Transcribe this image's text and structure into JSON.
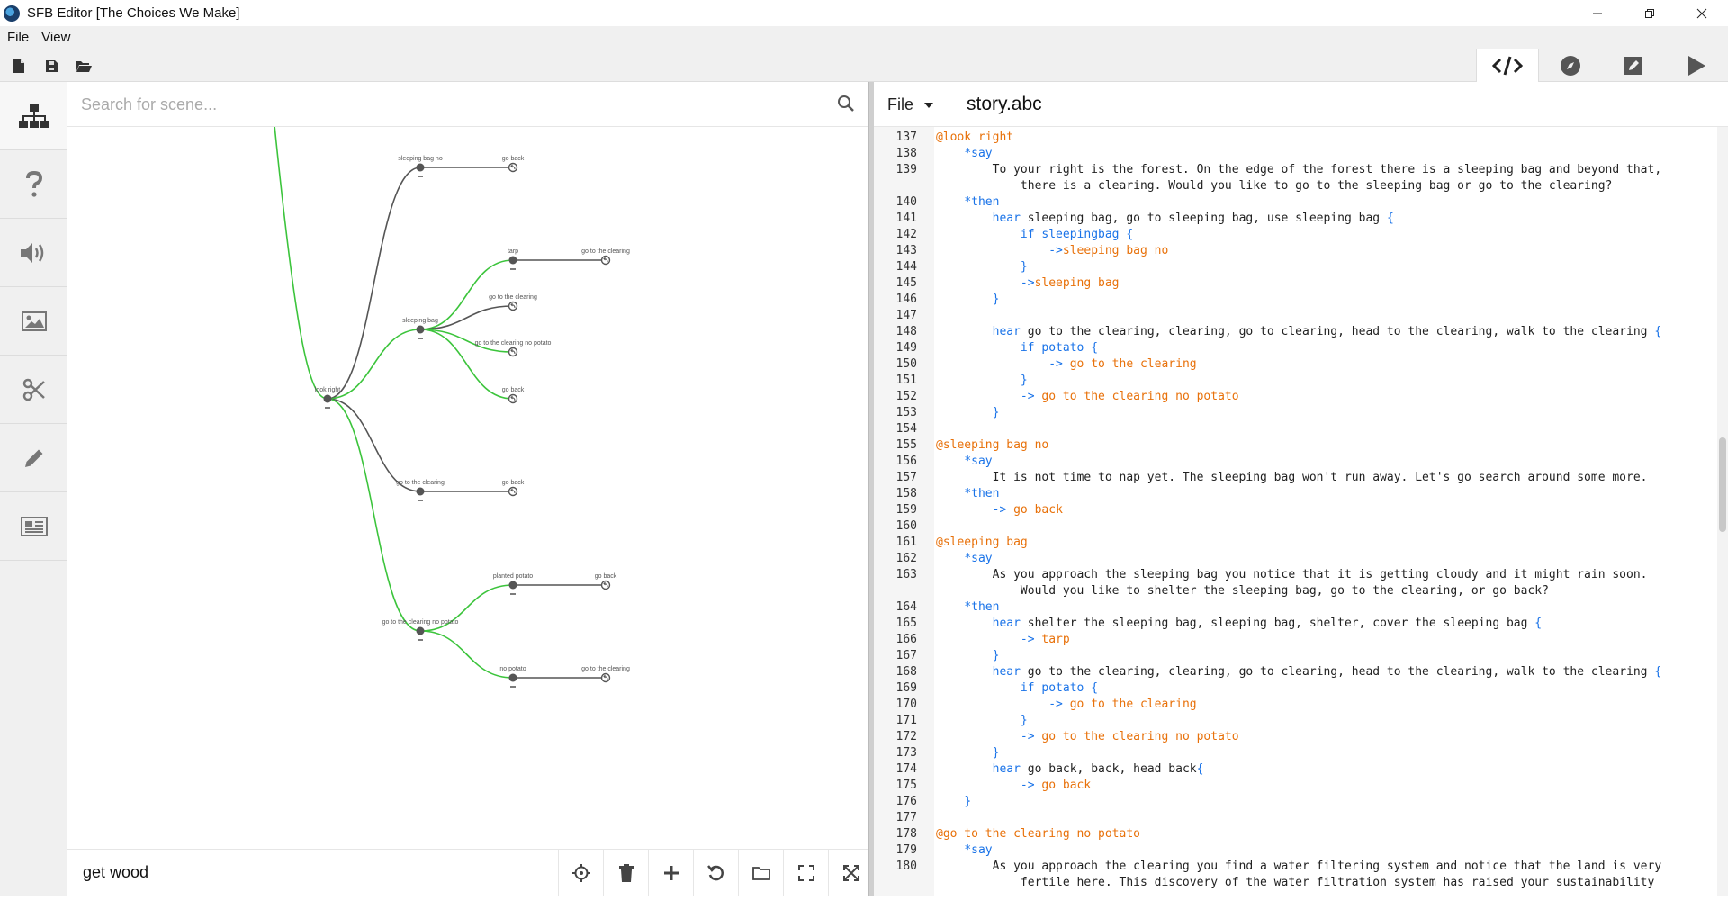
{
  "window": {
    "title": "SFB Editor [The Choices We Make]",
    "controls": [
      "minimize-icon",
      "restore-icon",
      "close-icon"
    ]
  },
  "menu": {
    "items": [
      "File",
      "View"
    ]
  },
  "toolbar": {
    "left": [
      "new-file-icon",
      "save-icon",
      "open-folder-icon"
    ],
    "modes": [
      {
        "name": "code-mode-icon",
        "active": true
      },
      {
        "name": "compass-icon",
        "active": false
      },
      {
        "name": "edit-mode-icon",
        "active": false
      },
      {
        "name": "play-icon",
        "active": false
      }
    ]
  },
  "sidebar": {
    "items": [
      "scene-tree-icon",
      "help-icon",
      "sound-icon",
      "image-icon",
      "scissors-icon",
      "pencil-icon",
      "newspaper-icon"
    ],
    "active_index": 0
  },
  "scene_pane": {
    "search_placeholder": "Search for scene...",
    "current_scene": "get wood",
    "bottom_tools": [
      "crosshair-icon",
      "trash-icon",
      "plus-icon",
      "undo-icon",
      "folder-icon",
      "fit-screen-icon",
      "expand-icon"
    ]
  },
  "graph": {
    "nodes": [
      {
        "id": "look_right",
        "label": "look right",
        "kind": "scene"
      },
      {
        "id": "sleeping_bag_no",
        "label": "sleeping bag no",
        "kind": "scene"
      },
      {
        "id": "sbn_go_back",
        "label": "go back",
        "kind": "return"
      },
      {
        "id": "sleeping_bag",
        "label": "sleeping bag",
        "kind": "scene"
      },
      {
        "id": "tarp",
        "label": "tarp",
        "kind": "scene"
      },
      {
        "id": "tarp_clearing",
        "label": "go to the clearing",
        "kind": "return"
      },
      {
        "id": "sb_clearing",
        "label": "go to the clearing",
        "kind": "return"
      },
      {
        "id": "sb_clearing_np",
        "label": "go to the clearing no potato",
        "kind": "return"
      },
      {
        "id": "sb_go_back",
        "label": "go back",
        "kind": "return"
      },
      {
        "id": "go_clearing",
        "label": "go to the clearing",
        "kind": "scene"
      },
      {
        "id": "gc_go_back",
        "label": "go back",
        "kind": "return"
      },
      {
        "id": "clearing_np",
        "label": "go to the clearing no potato",
        "kind": "scene"
      },
      {
        "id": "planted_potato",
        "label": "planted potato",
        "kind": "scene"
      },
      {
        "id": "pp_go_back",
        "label": "go back",
        "kind": "return"
      },
      {
        "id": "no_potato",
        "label": "no potato",
        "kind": "scene"
      },
      {
        "id": "np_clearing",
        "label": "go to the clearing",
        "kind": "return"
      }
    ],
    "edges": [
      {
        "from": "parent",
        "to": "look_right",
        "status": "green"
      },
      {
        "from": "look_right",
        "to": "sleeping_bag_no",
        "status": "gray"
      },
      {
        "from": "sleeping_bag_no",
        "to": "sbn_go_back",
        "status": "gray"
      },
      {
        "from": "look_right",
        "to": "sleeping_bag",
        "status": "green"
      },
      {
        "from": "sleeping_bag",
        "to": "tarp",
        "status": "green"
      },
      {
        "from": "tarp",
        "to": "tarp_clearing",
        "status": "gray"
      },
      {
        "from": "sleeping_bag",
        "to": "sb_clearing",
        "status": "gray"
      },
      {
        "from": "sleeping_bag",
        "to": "sb_clearing_np",
        "status": "green"
      },
      {
        "from": "sleeping_bag",
        "to": "sb_go_back",
        "status": "green"
      },
      {
        "from": "look_right",
        "to": "go_clearing",
        "status": "gray"
      },
      {
        "from": "go_clearing",
        "to": "gc_go_back",
        "status": "gray"
      },
      {
        "from": "look_right",
        "to": "clearing_np",
        "status": "green"
      },
      {
        "from": "clearing_np",
        "to": "planted_potato",
        "status": "green"
      },
      {
        "from": "planted_potato",
        "to": "pp_go_back",
        "status": "gray"
      },
      {
        "from": "clearing_np",
        "to": "no_potato",
        "status": "green"
      },
      {
        "from": "no_potato",
        "to": "np_clearing",
        "status": "gray"
      }
    ],
    "colors": {
      "green": "#3cc43c",
      "gray": "#555555",
      "node": "#555555"
    }
  },
  "editor": {
    "file_menu_label": "File",
    "filename": "story.abc",
    "lines": [
      {
        "n": "137",
        "segs": [
          [
            "scene",
            "@look right"
          ]
        ]
      },
      {
        "n": "138",
        "segs": [
          [
            "plain",
            "    "
          ],
          [
            "kw",
            "*say"
          ]
        ]
      },
      {
        "n": "139",
        "segs": [
          [
            "plain",
            "        To your right is the forest. On the edge of the forest there is a sleeping bag and beyond that,"
          ]
        ]
      },
      {
        "n": "",
        "segs": [
          [
            "plain",
            "            there is a clearing. Would you like to go to the sleeping bag or go to the clearing?"
          ]
        ]
      },
      {
        "n": "140",
        "segs": [
          [
            "plain",
            "    "
          ],
          [
            "kw",
            "*then"
          ]
        ]
      },
      {
        "n": "141",
        "segs": [
          [
            "plain",
            "        "
          ],
          [
            "kw",
            "hear"
          ],
          [
            "plain",
            " sleeping bag, go to sleeping bag, use sleeping bag "
          ],
          [
            "brace",
            "{"
          ]
        ]
      },
      {
        "n": "142",
        "segs": [
          [
            "plain",
            "            "
          ],
          [
            "kw",
            "if"
          ],
          [
            "plain",
            " "
          ],
          [
            "kw",
            "sleepingbag"
          ],
          [
            "plain",
            " "
          ],
          [
            "brace",
            "{"
          ]
        ]
      },
      {
        "n": "143",
        "segs": [
          [
            "plain",
            "                "
          ],
          [
            "kw",
            "->"
          ],
          [
            "goto",
            "sleeping bag no"
          ]
        ]
      },
      {
        "n": "144",
        "segs": [
          [
            "plain",
            "            "
          ],
          [
            "brace",
            "}"
          ]
        ]
      },
      {
        "n": "145",
        "segs": [
          [
            "plain",
            "            "
          ],
          [
            "kw",
            "->"
          ],
          [
            "goto",
            "sleeping bag"
          ]
        ]
      },
      {
        "n": "146",
        "segs": [
          [
            "plain",
            "        "
          ],
          [
            "brace",
            "}"
          ]
        ]
      },
      {
        "n": "147",
        "segs": [
          [
            "plain",
            ""
          ]
        ]
      },
      {
        "n": "148",
        "segs": [
          [
            "plain",
            "        "
          ],
          [
            "kw",
            "hear"
          ],
          [
            "plain",
            " go to the clearing, clearing, go to clearing, head to the clearing, walk to the clearing "
          ],
          [
            "brace",
            "{"
          ]
        ]
      },
      {
        "n": "149",
        "segs": [
          [
            "plain",
            "            "
          ],
          [
            "kw",
            "if"
          ],
          [
            "plain",
            " "
          ],
          [
            "kw",
            "potato"
          ],
          [
            "plain",
            " "
          ],
          [
            "brace",
            "{"
          ]
        ]
      },
      {
        "n": "150",
        "segs": [
          [
            "plain",
            "                "
          ],
          [
            "kw",
            "->"
          ],
          [
            "goto",
            " go to the clearing"
          ]
        ]
      },
      {
        "n": "151",
        "segs": [
          [
            "plain",
            "            "
          ],
          [
            "brace",
            "}"
          ]
        ]
      },
      {
        "n": "152",
        "segs": [
          [
            "plain",
            "            "
          ],
          [
            "kw",
            "->"
          ],
          [
            "goto",
            " go to the clearing no potato"
          ]
        ]
      },
      {
        "n": "153",
        "segs": [
          [
            "plain",
            "        "
          ],
          [
            "brace",
            "}"
          ]
        ]
      },
      {
        "n": "154",
        "segs": [
          [
            "plain",
            ""
          ]
        ]
      },
      {
        "n": "155",
        "segs": [
          [
            "scene",
            "@sleeping bag no"
          ]
        ]
      },
      {
        "n": "156",
        "segs": [
          [
            "plain",
            "    "
          ],
          [
            "kw",
            "*say"
          ]
        ]
      },
      {
        "n": "157",
        "segs": [
          [
            "plain",
            "        It is not time to nap yet. The sleeping bag won't run away. Let's go search around some more."
          ]
        ]
      },
      {
        "n": "158",
        "segs": [
          [
            "plain",
            "    "
          ],
          [
            "kw",
            "*then"
          ]
        ]
      },
      {
        "n": "159",
        "segs": [
          [
            "plain",
            "        "
          ],
          [
            "kw",
            "->"
          ],
          [
            "goto",
            " go back"
          ]
        ]
      },
      {
        "n": "160",
        "segs": [
          [
            "plain",
            ""
          ]
        ]
      },
      {
        "n": "161",
        "segs": [
          [
            "scene",
            "@sleeping bag"
          ]
        ]
      },
      {
        "n": "162",
        "segs": [
          [
            "plain",
            "    "
          ],
          [
            "kw",
            "*say"
          ]
        ]
      },
      {
        "n": "163",
        "segs": [
          [
            "plain",
            "        As you approach the sleeping bag you notice that it is getting cloudy and it might rain soon."
          ]
        ]
      },
      {
        "n": "",
        "segs": [
          [
            "plain",
            "            Would you like to shelter the sleeping bag, go to the clearing, or go back?"
          ]
        ]
      },
      {
        "n": "164",
        "segs": [
          [
            "plain",
            "    "
          ],
          [
            "kw",
            "*then"
          ]
        ]
      },
      {
        "n": "165",
        "segs": [
          [
            "plain",
            "        "
          ],
          [
            "kw",
            "hear"
          ],
          [
            "plain",
            " shelter the sleeping bag, sleeping bag, shelter, cover the sleeping bag "
          ],
          [
            "brace",
            "{"
          ]
        ]
      },
      {
        "n": "166",
        "segs": [
          [
            "plain",
            "            "
          ],
          [
            "kw",
            "->"
          ],
          [
            "goto",
            " tarp"
          ]
        ]
      },
      {
        "n": "167",
        "segs": [
          [
            "plain",
            "        "
          ],
          [
            "brace",
            "}"
          ]
        ]
      },
      {
        "n": "168",
        "segs": [
          [
            "plain",
            "        "
          ],
          [
            "kw",
            "hear"
          ],
          [
            "plain",
            " go to the clearing, clearing, go to clearing, head to the clearing, walk to the clearing "
          ],
          [
            "brace",
            "{"
          ]
        ]
      },
      {
        "n": "169",
        "segs": [
          [
            "plain",
            "            "
          ],
          [
            "kw",
            "if"
          ],
          [
            "plain",
            " "
          ],
          [
            "kw",
            "potato"
          ],
          [
            "plain",
            " "
          ],
          [
            "brace",
            "{"
          ]
        ]
      },
      {
        "n": "170",
        "segs": [
          [
            "plain",
            "                "
          ],
          [
            "kw",
            "->"
          ],
          [
            "goto",
            " go to the clearing"
          ]
        ]
      },
      {
        "n": "171",
        "segs": [
          [
            "plain",
            "            "
          ],
          [
            "brace",
            "}"
          ]
        ]
      },
      {
        "n": "172",
        "segs": [
          [
            "plain",
            "            "
          ],
          [
            "kw",
            "->"
          ],
          [
            "goto",
            " go to the clearing no potato"
          ]
        ]
      },
      {
        "n": "173",
        "segs": [
          [
            "plain",
            "        "
          ],
          [
            "brace",
            "}"
          ]
        ]
      },
      {
        "n": "174",
        "segs": [
          [
            "plain",
            "        "
          ],
          [
            "kw",
            "hear"
          ],
          [
            "plain",
            " go back, back, head back"
          ],
          [
            "brace",
            "{"
          ]
        ]
      },
      {
        "n": "175",
        "segs": [
          [
            "plain",
            "            "
          ],
          [
            "kw",
            "->"
          ],
          [
            "goto",
            " go back"
          ]
        ]
      },
      {
        "n": "176",
        "segs": [
          [
            "plain",
            "    "
          ],
          [
            "brace",
            "}"
          ]
        ]
      },
      {
        "n": "177",
        "segs": [
          [
            "plain",
            ""
          ]
        ]
      },
      {
        "n": "178",
        "segs": [
          [
            "scene",
            "@go to the clearing no potato"
          ]
        ]
      },
      {
        "n": "179",
        "segs": [
          [
            "plain",
            "    "
          ],
          [
            "kw",
            "*say"
          ]
        ]
      },
      {
        "n": "180",
        "segs": [
          [
            "plain",
            "        As you approach the clearing you find a water filtering system and notice that the land is very"
          ]
        ]
      },
      {
        "n": "",
        "segs": [
          [
            "plain",
            "            fertile here. This discovery of the water filtration system has raised your sustainability"
          ]
        ]
      }
    ]
  }
}
